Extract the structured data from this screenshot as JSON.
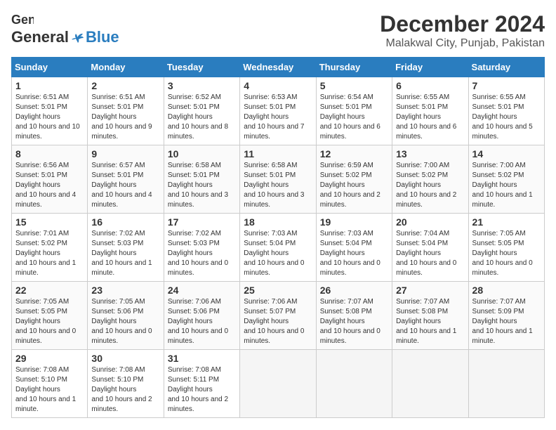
{
  "logo": {
    "general": "General",
    "blue": "Blue"
  },
  "title": "December 2024",
  "location": "Malakwal City, Punjab, Pakistan",
  "weekdays": [
    "Sunday",
    "Monday",
    "Tuesday",
    "Wednesday",
    "Thursday",
    "Friday",
    "Saturday"
  ],
  "weeks": [
    [
      {
        "day": "1",
        "sunrise": "6:51 AM",
        "sunset": "5:01 PM",
        "daylight": "10 hours and 10 minutes."
      },
      {
        "day": "2",
        "sunrise": "6:51 AM",
        "sunset": "5:01 PM",
        "daylight": "10 hours and 9 minutes."
      },
      {
        "day": "3",
        "sunrise": "6:52 AM",
        "sunset": "5:01 PM",
        "daylight": "10 hours and 8 minutes."
      },
      {
        "day": "4",
        "sunrise": "6:53 AM",
        "sunset": "5:01 PM",
        "daylight": "10 hours and 7 minutes."
      },
      {
        "day": "5",
        "sunrise": "6:54 AM",
        "sunset": "5:01 PM",
        "daylight": "10 hours and 6 minutes."
      },
      {
        "day": "6",
        "sunrise": "6:55 AM",
        "sunset": "5:01 PM",
        "daylight": "10 hours and 6 minutes."
      },
      {
        "day": "7",
        "sunrise": "6:55 AM",
        "sunset": "5:01 PM",
        "daylight": "10 hours and 5 minutes."
      }
    ],
    [
      {
        "day": "8",
        "sunrise": "6:56 AM",
        "sunset": "5:01 PM",
        "daylight": "10 hours and 4 minutes."
      },
      {
        "day": "9",
        "sunrise": "6:57 AM",
        "sunset": "5:01 PM",
        "daylight": "10 hours and 4 minutes."
      },
      {
        "day": "10",
        "sunrise": "6:58 AM",
        "sunset": "5:01 PM",
        "daylight": "10 hours and 3 minutes."
      },
      {
        "day": "11",
        "sunrise": "6:58 AM",
        "sunset": "5:01 PM",
        "daylight": "10 hours and 3 minutes."
      },
      {
        "day": "12",
        "sunrise": "6:59 AM",
        "sunset": "5:02 PM",
        "daylight": "10 hours and 2 minutes."
      },
      {
        "day": "13",
        "sunrise": "7:00 AM",
        "sunset": "5:02 PM",
        "daylight": "10 hours and 2 minutes."
      },
      {
        "day": "14",
        "sunrise": "7:00 AM",
        "sunset": "5:02 PM",
        "daylight": "10 hours and 1 minute."
      }
    ],
    [
      {
        "day": "15",
        "sunrise": "7:01 AM",
        "sunset": "5:02 PM",
        "daylight": "10 hours and 1 minute."
      },
      {
        "day": "16",
        "sunrise": "7:02 AM",
        "sunset": "5:03 PM",
        "daylight": "10 hours and 1 minute."
      },
      {
        "day": "17",
        "sunrise": "7:02 AM",
        "sunset": "5:03 PM",
        "daylight": "10 hours and 0 minutes."
      },
      {
        "day": "18",
        "sunrise": "7:03 AM",
        "sunset": "5:04 PM",
        "daylight": "10 hours and 0 minutes."
      },
      {
        "day": "19",
        "sunrise": "7:03 AM",
        "sunset": "5:04 PM",
        "daylight": "10 hours and 0 minutes."
      },
      {
        "day": "20",
        "sunrise": "7:04 AM",
        "sunset": "5:04 PM",
        "daylight": "10 hours and 0 minutes."
      },
      {
        "day": "21",
        "sunrise": "7:05 AM",
        "sunset": "5:05 PM",
        "daylight": "10 hours and 0 minutes."
      }
    ],
    [
      {
        "day": "22",
        "sunrise": "7:05 AM",
        "sunset": "5:05 PM",
        "daylight": "10 hours and 0 minutes."
      },
      {
        "day": "23",
        "sunrise": "7:05 AM",
        "sunset": "5:06 PM",
        "daylight": "10 hours and 0 minutes."
      },
      {
        "day": "24",
        "sunrise": "7:06 AM",
        "sunset": "5:06 PM",
        "daylight": "10 hours and 0 minutes."
      },
      {
        "day": "25",
        "sunrise": "7:06 AM",
        "sunset": "5:07 PM",
        "daylight": "10 hours and 0 minutes."
      },
      {
        "day": "26",
        "sunrise": "7:07 AM",
        "sunset": "5:08 PM",
        "daylight": "10 hours and 0 minutes."
      },
      {
        "day": "27",
        "sunrise": "7:07 AM",
        "sunset": "5:08 PM",
        "daylight": "10 hours and 1 minute."
      },
      {
        "day": "28",
        "sunrise": "7:07 AM",
        "sunset": "5:09 PM",
        "daylight": "10 hours and 1 minute."
      }
    ],
    [
      {
        "day": "29",
        "sunrise": "7:08 AM",
        "sunset": "5:10 PM",
        "daylight": "10 hours and 1 minute."
      },
      {
        "day": "30",
        "sunrise": "7:08 AM",
        "sunset": "5:10 PM",
        "daylight": "10 hours and 2 minutes."
      },
      {
        "day": "31",
        "sunrise": "7:08 AM",
        "sunset": "5:11 PM",
        "daylight": "10 hours and 2 minutes."
      },
      null,
      null,
      null,
      null
    ]
  ]
}
